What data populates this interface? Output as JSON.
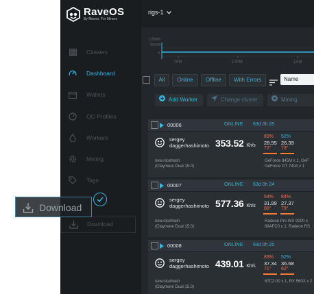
{
  "brand": {
    "name": "RaveOS",
    "tagline": "By Miners. For Miners"
  },
  "topbar": {
    "rig_selector": "rigs-1"
  },
  "sidebar": {
    "items": [
      {
        "label": "Clusters",
        "icon": "grid-icon",
        "active": false
      },
      {
        "label": "Dashboard",
        "icon": "speedometer-icon",
        "active": true
      },
      {
        "label": "Wallets",
        "icon": "wallet-icon",
        "active": false
      },
      {
        "label": "OC Profiles",
        "icon": "gauge-icon",
        "active": false
      },
      {
        "label": "Workers",
        "icon": "drop-icon",
        "active": false
      },
      {
        "label": "Mining",
        "icon": "gear-icon",
        "active": false
      },
      {
        "label": "Tags",
        "icon": "tag-icon",
        "active": false
      }
    ],
    "download_label": "Download"
  },
  "chart": {
    "y_ticks": [
      "119898",
      "59949",
      "0"
    ],
    "x_ticks": [
      "7PM",
      "10PM",
      "1AM"
    ]
  },
  "filters": {
    "all": "All",
    "online": "Online",
    "offline": "Offline",
    "with_errors": "With Errors",
    "sort_field": "Name"
  },
  "actions": {
    "add_worker": "Add Worker",
    "change_cluster": "Change cluster",
    "mining": "Mining"
  },
  "workers": [
    {
      "id": "00006",
      "status": "ONLINE",
      "uptime": "63d 0h 25",
      "user": "sergey",
      "algo": "daggerhashimoto",
      "hashrate": "353.52",
      "unit": "Kh/s",
      "gpus": [
        {
          "pct": "89%",
          "mh": "28.95",
          "temp": "72°",
          "pct_color": "orange"
        },
        {
          "pct": "52%",
          "mh": "26.39",
          "temp": "73°",
          "pct_color": "blue"
        }
      ],
      "pool": "new.nicehash",
      "miner": "(Claymore Dual 15.0)",
      "gpu_line1": "GeForce 845M x 1, GeF",
      "gpu_line2": "GeForce GT 740A x 1"
    },
    {
      "id": "00007",
      "status": "ONLINE",
      "uptime": "63d 0h 24",
      "user": "sergey",
      "algo": "daggerhashimoto",
      "hashrate": "577.36",
      "unit": "Kh/s",
      "gpus": [
        {
          "pct": "54%",
          "mh": "31.99",
          "temp": "66°",
          "pct_color": "orange"
        },
        {
          "pct": "84%",
          "mh": "27.37",
          "temp": "79°",
          "pct_color": "orange"
        }
      ],
      "pool": "new.nicehash",
      "miner": "(Claymore Dual 15.0)",
      "gpu_line1": "Radeon Pro WX 9100 x",
      "gpu_line2": "69AFC0 x 1, Radeon RS"
    },
    {
      "id": "00008",
      "status": "ONLINE",
      "uptime": "63d 0h 25",
      "user": "sergey",
      "algo": "daggerhashimoto",
      "hashrate": "439.01",
      "unit": "Kh/s",
      "gpus": [
        {
          "pct": "83%",
          "mh": "37.34",
          "temp": "71°",
          "pct_color": "orange"
        },
        {
          "pct": "52%",
          "mh": "36.68",
          "temp": "62°",
          "pct_color": "blue"
        }
      ],
      "pool": "new.nicehash",
      "miner": "(Claymore Dual 15.0)",
      "gpu_line1": "67C2:00 x 1, RX 560X x 2",
      "gpu_line2": ""
    }
  ],
  "download_overlay": {
    "label": "Download"
  },
  "colors": {
    "accent": "#34b7e5",
    "warning": "#ff6a4b",
    "background": "#1c1f22"
  }
}
